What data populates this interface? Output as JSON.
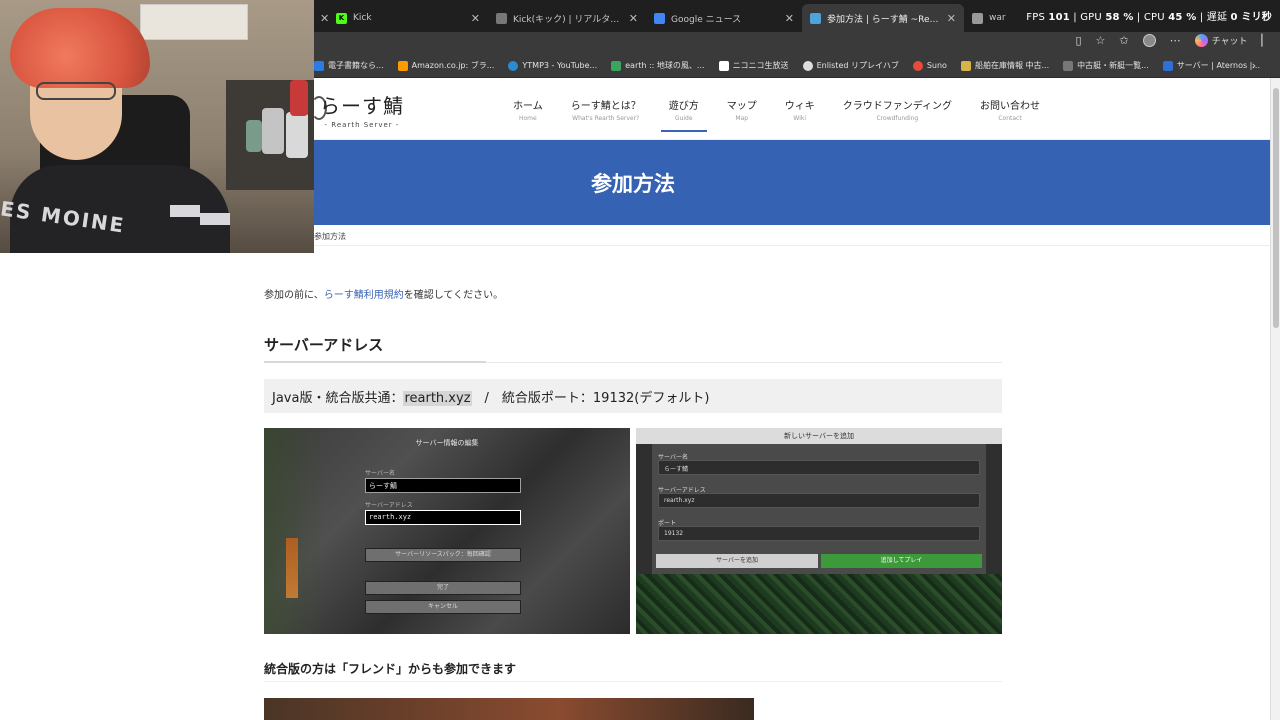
{
  "browser": {
    "tabs": [
      {
        "title": "Kick",
        "active": false,
        "color": "#53fc18"
      },
      {
        "title": "Kick(キック) | リアルタイムランキング",
        "active": false,
        "color": "#777777"
      },
      {
        "title": "Google ニュース",
        "active": false,
        "color": "#4285f4"
      },
      {
        "title": "参加方法 | らーす鯖 ~Rearth Server",
        "active": true,
        "color": "#4fa3d9"
      },
      {
        "title": "war",
        "active": false,
        "color": "#999999"
      }
    ],
    "perf": {
      "fps_label": "FPS",
      "fps": "101",
      "gpu_label": "GPU",
      "gpu": "58 %",
      "cpu_label": "CPU",
      "cpu": "45 %",
      "latency_label": "遅延",
      "latency": "0 ミリ秒"
    },
    "toolbar": {
      "chat_label": "チャット"
    },
    "bookmarks": [
      {
        "label": "電子書籍なら...",
        "color": "#2c7be5"
      },
      {
        "label": "Amazon.co.jp: ブラ...",
        "color": "#ff9900"
      },
      {
        "label": "YTMP3 - YouTube...",
        "color": "#2a8bd1"
      },
      {
        "label": "earth :: 地球の風、...",
        "color": "#3aa55c"
      },
      {
        "label": "ニコニコ生放送",
        "color": "#ffffff"
      },
      {
        "label": "Enlisted リプレイハブ",
        "color": "#dddddd"
      },
      {
        "label": "Suno",
        "color": "#e84b3c"
      },
      {
        "label": "船舶在庫情報 中古...",
        "color": "#d6b44a"
      },
      {
        "label": "中古艇・新艇一覧...",
        "color": "#777777"
      },
      {
        "label": "サーバー | Aternos |...",
        "color": "#2f6fd6"
      }
    ]
  },
  "site": {
    "logo_main": "らーす鯖",
    "logo_sub": "- Rearth Server -",
    "nav": [
      {
        "jp": "ホーム",
        "en": "Home",
        "active": false
      },
      {
        "jp": "らーす鯖とは？",
        "en": "What's Rearth Server?",
        "active": false
      },
      {
        "jp": "遊び方",
        "en": "Guide",
        "active": true
      },
      {
        "jp": "マップ",
        "en": "Map",
        "active": false
      },
      {
        "jp": "ウィキ",
        "en": "Wiki",
        "active": false
      },
      {
        "jp": "クラウドファンディング",
        "en": "Crowdfunding",
        "active": false
      },
      {
        "jp": "お問い合わせ",
        "en": "Contact",
        "active": false
      }
    ],
    "banner_title": "参加方法",
    "breadcrumb": "参加方法",
    "intro_before": "参加の前に、",
    "intro_link": "らーす鯖利用規約",
    "intro_after": "を確認してください。",
    "section_title": "サーバーアドレス",
    "address_prefix": "Java版・統合版共通：",
    "address_value": "rearth.xyz",
    "address_suffix": "　/　統合版ポート：19132(デフォルト)",
    "java_screen": {
      "title": "サーバー情報の編集",
      "name_label": "サーバー名",
      "name_value": "らーす鯖",
      "addr_label": "サーバーアドレス",
      "addr_value": "rearth.xyz",
      "resource_btn": "サーバーリソースパック：毎回確認",
      "done_btn": "完了",
      "cancel_btn": "キャンセル"
    },
    "bedrock_screen": {
      "title": "新しいサーバーを追加",
      "name_label": "サーバー名",
      "name_value": "らーす鯖",
      "addr_label": "サーバーアドレス",
      "addr_value": "rearth.xyz",
      "port_label": "ポート",
      "port_value": "19132",
      "add_btn": "サーバーを追加",
      "play_btn": "追加してプレイ"
    },
    "friend_heading": "統合版の方は「フレンド」からも参加できます",
    "webcam_shirt_text": "ES MOINE"
  }
}
